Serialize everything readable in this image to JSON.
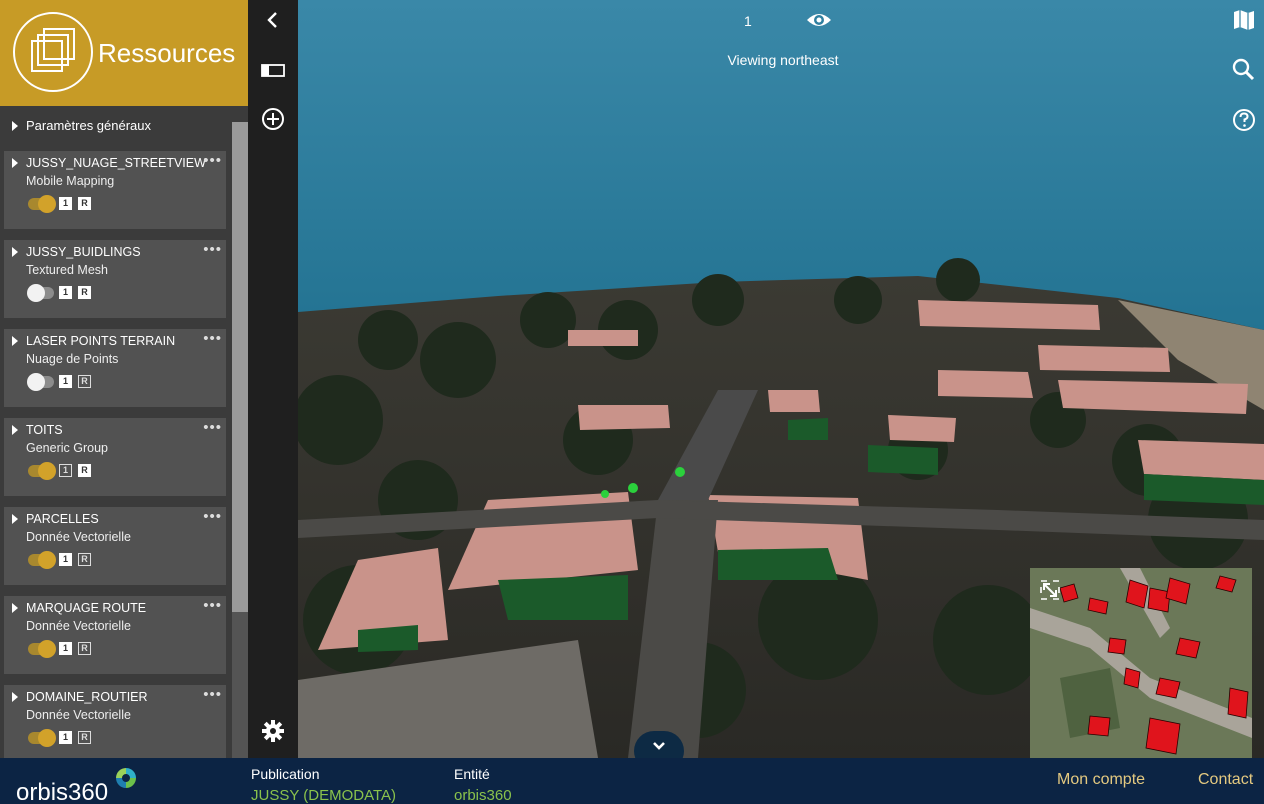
{
  "panel": {
    "title": "Ressources",
    "general_params": "Paramètres généraux",
    "layers": [
      {
        "name": "JUSSY_NUAGE_STREETVIEW",
        "type": "Mobile Mapping",
        "visible": true,
        "badge1": "1",
        "badge2": "R",
        "badge1_filled": true,
        "badge2_filled": true
      },
      {
        "name": "JUSSY_BUIDLINGS",
        "type": "Textured Mesh",
        "visible": false,
        "badge1": "1",
        "badge2": "R",
        "badge1_filled": true,
        "badge2_filled": true
      },
      {
        "name": "LASER POINTS TERRAIN",
        "type": "Nuage de Points",
        "visible": false,
        "badge1": "1",
        "badge2": "R",
        "badge1_filled": true,
        "badge2_filled": false
      },
      {
        "name": "TOITS",
        "type": "Generic Group",
        "visible": true,
        "badge1": "1",
        "badge2": "R",
        "badge1_filled": false,
        "badge2_filled": true
      },
      {
        "name": "PARCELLES",
        "type": "Donnée Vectorielle",
        "visible": true,
        "badge1": "1",
        "badge2": "R",
        "badge1_filled": true,
        "badge2_filled": false
      },
      {
        "name": "MARQUAGE ROUTE",
        "type": "Donnée Vectorielle",
        "visible": true,
        "badge1": "1",
        "badge2": "R",
        "badge1_filled": true,
        "badge2_filled": false
      },
      {
        "name": "DOMAINE_ROUTIER",
        "type": "Donnée Vectorielle",
        "visible": true,
        "badge1": "1",
        "badge2": "R",
        "badge1_filled": true,
        "badge2_filled": false
      }
    ],
    "layer_menu_glyph": "•••"
  },
  "rail": {
    "icons": [
      "chevron-left-icon",
      "panel-toggle-icon",
      "add-circle-icon",
      "settings-gear-icon"
    ]
  },
  "viewer": {
    "zoom_level": "1",
    "view_direction": "Viewing northeast",
    "icons": [
      "eye-icon",
      "map-icon",
      "search-icon",
      "help-icon",
      "expand-icon",
      "chevron-down-icon"
    ]
  },
  "footer": {
    "brand": "orbis360",
    "publication_label": "Publication",
    "publication_value": "JUSSY (DEMODATA)",
    "entity_label": "Entité",
    "entity_value": "orbis360",
    "account_link": "Mon compte",
    "contact_link": "Contact"
  },
  "colors": {
    "header_gold": "#c79b26",
    "panel_bg": "#3b3b3b",
    "card_bg": "#525252",
    "footer_bg": "#0c2444",
    "footer_value": "#8ac24c",
    "footer_link": "#e4c980",
    "sky": "#2f7fa0"
  }
}
